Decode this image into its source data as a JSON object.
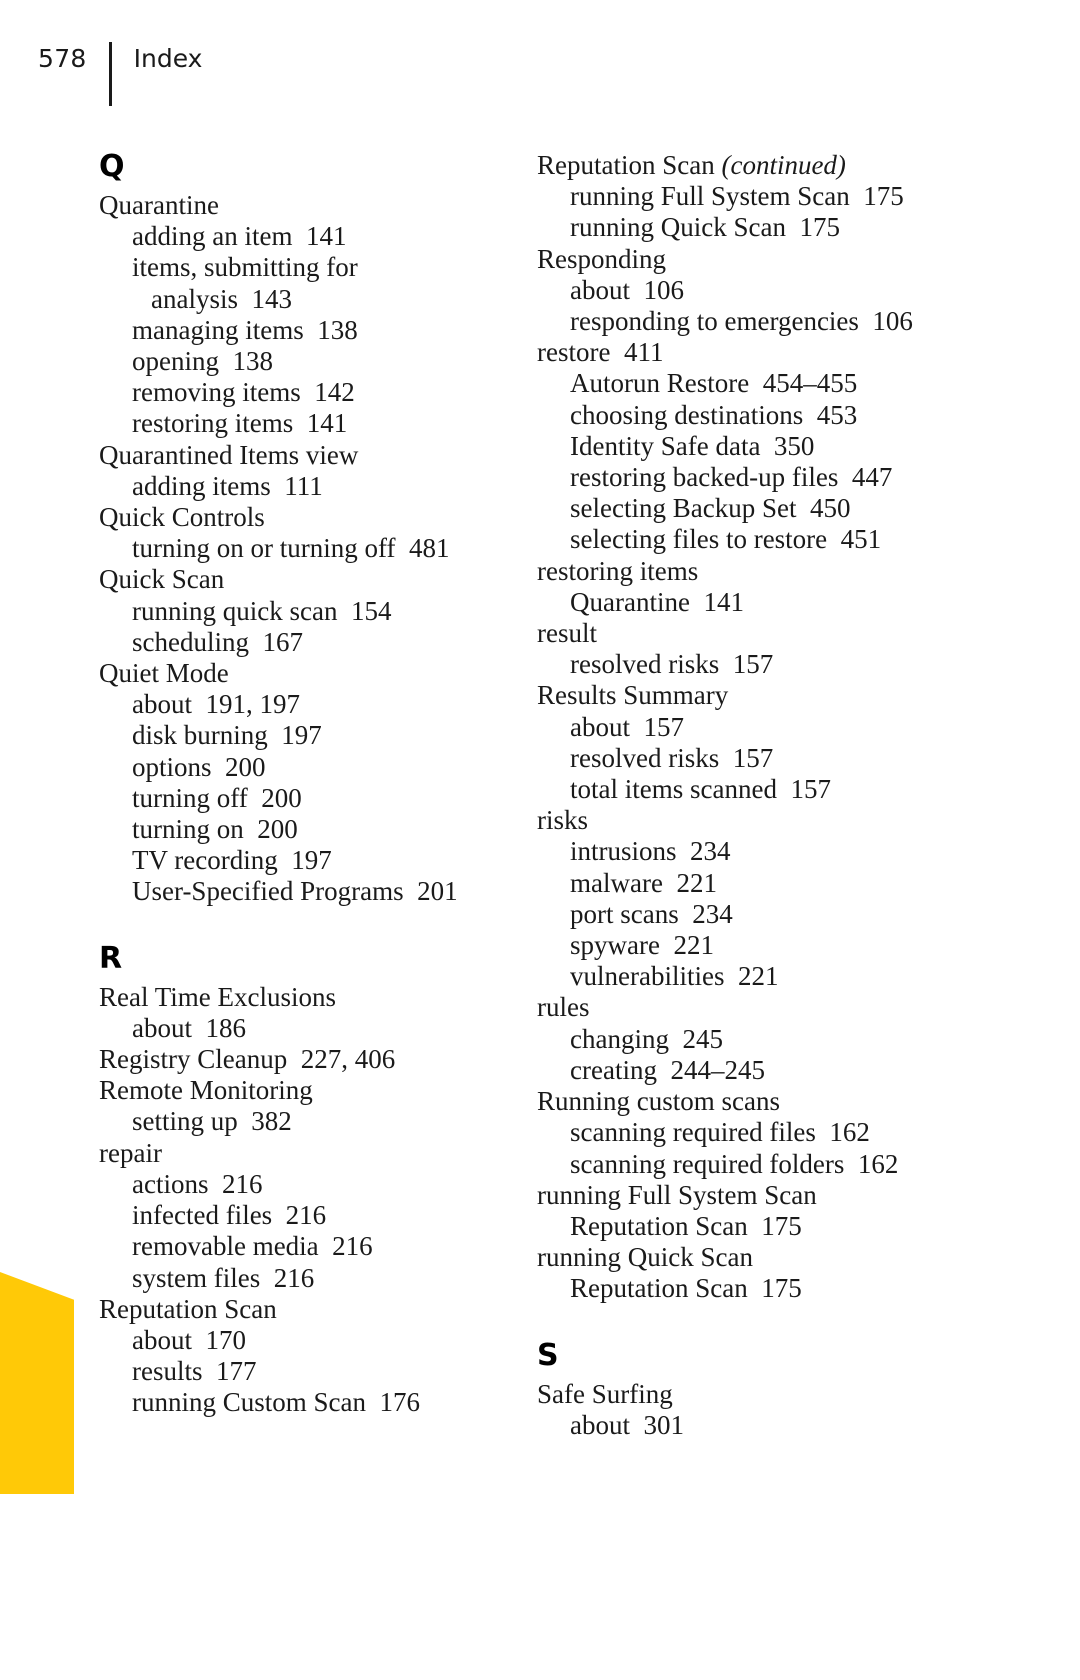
{
  "header": {
    "folio": "578",
    "title": "Index"
  },
  "decor": {
    "thumb_tab_color": "#FFC907"
  },
  "columns": {
    "left": [
      {
        "type": "letter",
        "text": "Q"
      },
      {
        "type": "entry",
        "level": 0,
        "text": "Quarantine"
      },
      {
        "type": "entry",
        "level": 1,
        "text": "adding an item  141"
      },
      {
        "type": "entry",
        "level": 1,
        "text": "items, submitting for"
      },
      {
        "type": "entry",
        "level": 2,
        "text": "analysis  143"
      },
      {
        "type": "entry",
        "level": 1,
        "text": "managing items  138"
      },
      {
        "type": "entry",
        "level": 1,
        "text": "opening  138"
      },
      {
        "type": "entry",
        "level": 1,
        "text": "removing items  142"
      },
      {
        "type": "entry",
        "level": 1,
        "text": "restoring items  141"
      },
      {
        "type": "entry",
        "level": 0,
        "text": "Quarantined Items view"
      },
      {
        "type": "entry",
        "level": 1,
        "text": "adding items  111"
      },
      {
        "type": "entry",
        "level": 0,
        "text": "Quick Controls"
      },
      {
        "type": "entry",
        "level": 1,
        "text": "turning on or turning off  481"
      },
      {
        "type": "entry",
        "level": 0,
        "text": "Quick Scan"
      },
      {
        "type": "entry",
        "level": 1,
        "text": "running quick scan  154"
      },
      {
        "type": "entry",
        "level": 1,
        "text": "scheduling  167"
      },
      {
        "type": "entry",
        "level": 0,
        "text": "Quiet Mode"
      },
      {
        "type": "entry",
        "level": 1,
        "text": "about  191, 197"
      },
      {
        "type": "entry",
        "level": 1,
        "text": "disk burning  197"
      },
      {
        "type": "entry",
        "level": 1,
        "text": "options  200"
      },
      {
        "type": "entry",
        "level": 1,
        "text": "turning off  200"
      },
      {
        "type": "entry",
        "level": 1,
        "text": "turning on  200"
      },
      {
        "type": "entry",
        "level": 1,
        "text": "TV recording  197"
      },
      {
        "type": "entry",
        "level": 1,
        "text": "User-Specified Programs  201"
      },
      {
        "type": "letter",
        "text": "R",
        "spaced": true
      },
      {
        "type": "entry",
        "level": 0,
        "text": "Real Time Exclusions"
      },
      {
        "type": "entry",
        "level": 1,
        "text": "about  186"
      },
      {
        "type": "entry",
        "level": 0,
        "text": "Registry Cleanup  227, 406"
      },
      {
        "type": "entry",
        "level": 0,
        "text": "Remote Monitoring"
      },
      {
        "type": "entry",
        "level": 1,
        "text": "setting up  382"
      },
      {
        "type": "entry",
        "level": 0,
        "text": "repair"
      },
      {
        "type": "entry",
        "level": 1,
        "text": "actions  216"
      },
      {
        "type": "entry",
        "level": 1,
        "text": "infected files  216"
      },
      {
        "type": "entry",
        "level": 1,
        "text": "removable media  216"
      },
      {
        "type": "entry",
        "level": 1,
        "text": "system files  216"
      },
      {
        "type": "entry",
        "level": 0,
        "text": "Reputation Scan"
      },
      {
        "type": "entry",
        "level": 1,
        "text": "about  170"
      },
      {
        "type": "entry",
        "level": 1,
        "text": "results  177"
      },
      {
        "type": "entry",
        "level": 1,
        "text": "running Custom Scan  176"
      }
    ],
    "right": [
      {
        "type": "entry",
        "level": 0,
        "text": "Reputation Scan ",
        "continued": "(continued)"
      },
      {
        "type": "entry",
        "level": 1,
        "text": "running Full System Scan  175"
      },
      {
        "type": "entry",
        "level": 1,
        "text": "running Quick Scan  175"
      },
      {
        "type": "entry",
        "level": 0,
        "text": "Responding"
      },
      {
        "type": "entry",
        "level": 1,
        "text": "about  106"
      },
      {
        "type": "entry",
        "level": 1,
        "text": "responding to emergencies  106"
      },
      {
        "type": "entry",
        "level": 0,
        "text": "restore  411"
      },
      {
        "type": "entry",
        "level": 1,
        "text": "Autorun Restore  454–455"
      },
      {
        "type": "entry",
        "level": 1,
        "text": "choosing destinations  453"
      },
      {
        "type": "entry",
        "level": 1,
        "text": "Identity Safe data  350"
      },
      {
        "type": "entry",
        "level": 1,
        "text": "restoring backed-up files  447"
      },
      {
        "type": "entry",
        "level": 1,
        "text": "selecting Backup Set  450"
      },
      {
        "type": "entry",
        "level": 1,
        "text": "selecting files to restore  451"
      },
      {
        "type": "entry",
        "level": 0,
        "text": "restoring items"
      },
      {
        "type": "entry",
        "level": 1,
        "text": "Quarantine  141"
      },
      {
        "type": "entry",
        "level": 0,
        "text": "result"
      },
      {
        "type": "entry",
        "level": 1,
        "text": "resolved risks  157"
      },
      {
        "type": "entry",
        "level": 0,
        "text": "Results Summary"
      },
      {
        "type": "entry",
        "level": 1,
        "text": "about  157"
      },
      {
        "type": "entry",
        "level": 1,
        "text": "resolved risks  157"
      },
      {
        "type": "entry",
        "level": 1,
        "text": "total items scanned  157"
      },
      {
        "type": "entry",
        "level": 0,
        "text": "risks"
      },
      {
        "type": "entry",
        "level": 1,
        "text": "intrusions  234"
      },
      {
        "type": "entry",
        "level": 1,
        "text": "malware  221"
      },
      {
        "type": "entry",
        "level": 1,
        "text": "port scans  234"
      },
      {
        "type": "entry",
        "level": 1,
        "text": "spyware  221"
      },
      {
        "type": "entry",
        "level": 1,
        "text": "vulnerabilities  221"
      },
      {
        "type": "entry",
        "level": 0,
        "text": "rules"
      },
      {
        "type": "entry",
        "level": 1,
        "text": "changing  245"
      },
      {
        "type": "entry",
        "level": 1,
        "text": "creating  244–245"
      },
      {
        "type": "entry",
        "level": 0,
        "text": "Running custom scans"
      },
      {
        "type": "entry",
        "level": 1,
        "text": "scanning required files  162"
      },
      {
        "type": "entry",
        "level": 1,
        "text": "scanning required folders  162"
      },
      {
        "type": "entry",
        "level": 0,
        "text": "running Full System Scan"
      },
      {
        "type": "entry",
        "level": 1,
        "text": "Reputation Scan  175"
      },
      {
        "type": "entry",
        "level": 0,
        "text": "running Quick Scan"
      },
      {
        "type": "entry",
        "level": 1,
        "text": "Reputation Scan  175"
      },
      {
        "type": "letter",
        "text": "S",
        "spaced": true
      },
      {
        "type": "entry",
        "level": 0,
        "text": "Safe Surfing"
      },
      {
        "type": "entry",
        "level": 1,
        "text": "about  301"
      }
    ]
  }
}
